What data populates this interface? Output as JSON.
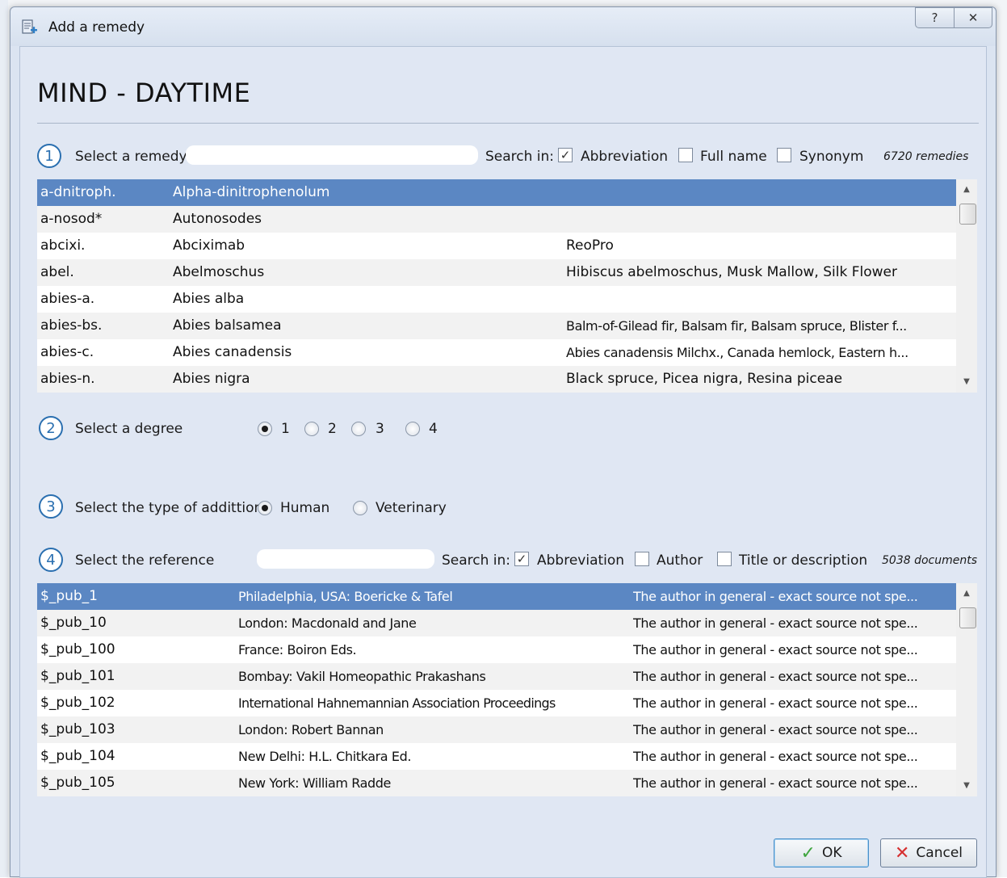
{
  "window": {
    "title": "Add a remedy",
    "help_label": "?",
    "close_label": "✕"
  },
  "heading": "MIND - DAYTIME",
  "step1": {
    "number": "1",
    "label": "Select a remedy",
    "search_value": "",
    "search_in_label": "Search in:",
    "options": [
      {
        "label": "Abbreviation",
        "checked": true
      },
      {
        "label": "Full name",
        "checked": false
      },
      {
        "label": "Synonym",
        "checked": false
      }
    ],
    "count": "6720 remedies"
  },
  "remedies": [
    {
      "abbr": "a-dnitroph.",
      "name": "Alpha-dinitrophenolum",
      "synonyms": "",
      "selected": true
    },
    {
      "abbr": "a-nosod*",
      "name": "Autonosodes",
      "synonyms": ""
    },
    {
      "abbr": "abcixi.",
      "name": "Abciximab",
      "synonyms": "ReoPro"
    },
    {
      "abbr": "abel.",
      "name": "Abelmoschus",
      "synonyms": "Hibiscus abelmoschus, Musk Mallow, Silk Flower"
    },
    {
      "abbr": "abies-a.",
      "name": "Abies alba",
      "synonyms": ""
    },
    {
      "abbr": "abies-bs.",
      "name": "Abies balsamea",
      "synonyms": "Balm-of-Gilead fir, Balsam fir, Balsam spruce, Blister f..."
    },
    {
      "abbr": "abies-c.",
      "name": "Abies canadensis",
      "synonyms": "Abies canadensis Milchx., Canada hemlock, Eastern h..."
    },
    {
      "abbr": "abies-n.",
      "name": "Abies nigra",
      "synonyms": "Black spruce, Picea nigra, Resina piceae"
    }
  ],
  "step2": {
    "number": "2",
    "label": "Select a degree",
    "options": [
      {
        "label": "1",
        "selected": true
      },
      {
        "label": "2",
        "selected": false
      },
      {
        "label": "3",
        "selected": false
      },
      {
        "label": "4",
        "selected": false
      }
    ]
  },
  "step3": {
    "number": "3",
    "label": "Select the type of addittion",
    "options": [
      {
        "label": "Human",
        "selected": true
      },
      {
        "label": "Veterinary",
        "selected": false
      }
    ]
  },
  "step4": {
    "number": "4",
    "label": "Select the reference",
    "search_value": "",
    "search_in_label": "Search in:",
    "options": [
      {
        "label": "Abbreviation",
        "checked": true
      },
      {
        "label": "Author",
        "checked": false
      },
      {
        "label": "Title or description",
        "checked": false
      }
    ],
    "count": "5038 documents"
  },
  "references": [
    {
      "abbr": "$_pub_1",
      "publisher": "Philadelphia, USA: Boericke & Tafel",
      "description": "The author in general - exact source not spe...",
      "selected": true
    },
    {
      "abbr": "$_pub_10",
      "publisher": "London: Macdonald and Jane",
      "description": "The author in general - exact source not spe..."
    },
    {
      "abbr": "$_pub_100",
      "publisher": "France: Boiron Eds.",
      "description": "The author in general - exact source not spe..."
    },
    {
      "abbr": "$_pub_101",
      "publisher": "Bombay: Vakil Homeopathic Prakashans",
      "description": "The author in general - exact source not spe..."
    },
    {
      "abbr": "$_pub_102",
      "publisher": "International Hahnemannian Association Proceedings",
      "description": "The author in general - exact source not spe..."
    },
    {
      "abbr": "$_pub_103",
      "publisher": "London: Robert Bannan",
      "description": "The author in general - exact source not spe..."
    },
    {
      "abbr": "$_pub_104",
      "publisher": "New Delhi: H.L. Chitkara Ed.",
      "description": "The author in general - exact source not spe..."
    },
    {
      "abbr": "$_pub_105",
      "publisher": "New York: William Radde",
      "description": "The author in general - exact source not spe..."
    }
  ],
  "buttons": {
    "ok_label": "OK",
    "cancel_label": "Cancel"
  },
  "colors": {
    "selection": "#5b87c3",
    "step_circle": "#2a6fb0",
    "dialog_bg": "#e0e7f3"
  }
}
